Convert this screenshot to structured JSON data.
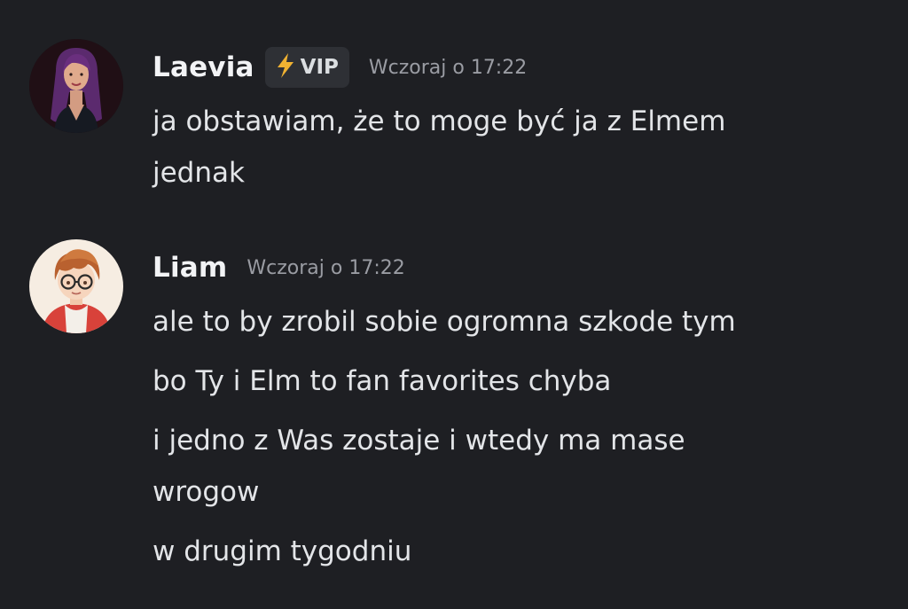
{
  "messages": [
    {
      "author": "Laevia",
      "badge": {
        "icon": "lightning-bolt-icon",
        "label": "VIP"
      },
      "timestamp": "Wczoraj o 17:22",
      "lines": [
        "ja obstawiam, że to moge być ja z Elmem",
        "jednak"
      ]
    },
    {
      "author": "Liam",
      "timestamp": "Wczoraj o 17:22",
      "lines": [
        "ale to by zrobil sobie ogromna szkode tym",
        "bo Ty i Elm to fan favorites chyba",
        "i jedno z Was zostaje i wtedy ma mase",
        "wrogow",
        "w drugim tygodniu"
      ]
    }
  ],
  "colors": {
    "background": "#1e1f23",
    "username": "#f2f3f5",
    "message_text": "#e3e5e8",
    "timestamp": "#9a9ca3",
    "badge_background": "#2e3035",
    "bolt": "#f0b232"
  }
}
